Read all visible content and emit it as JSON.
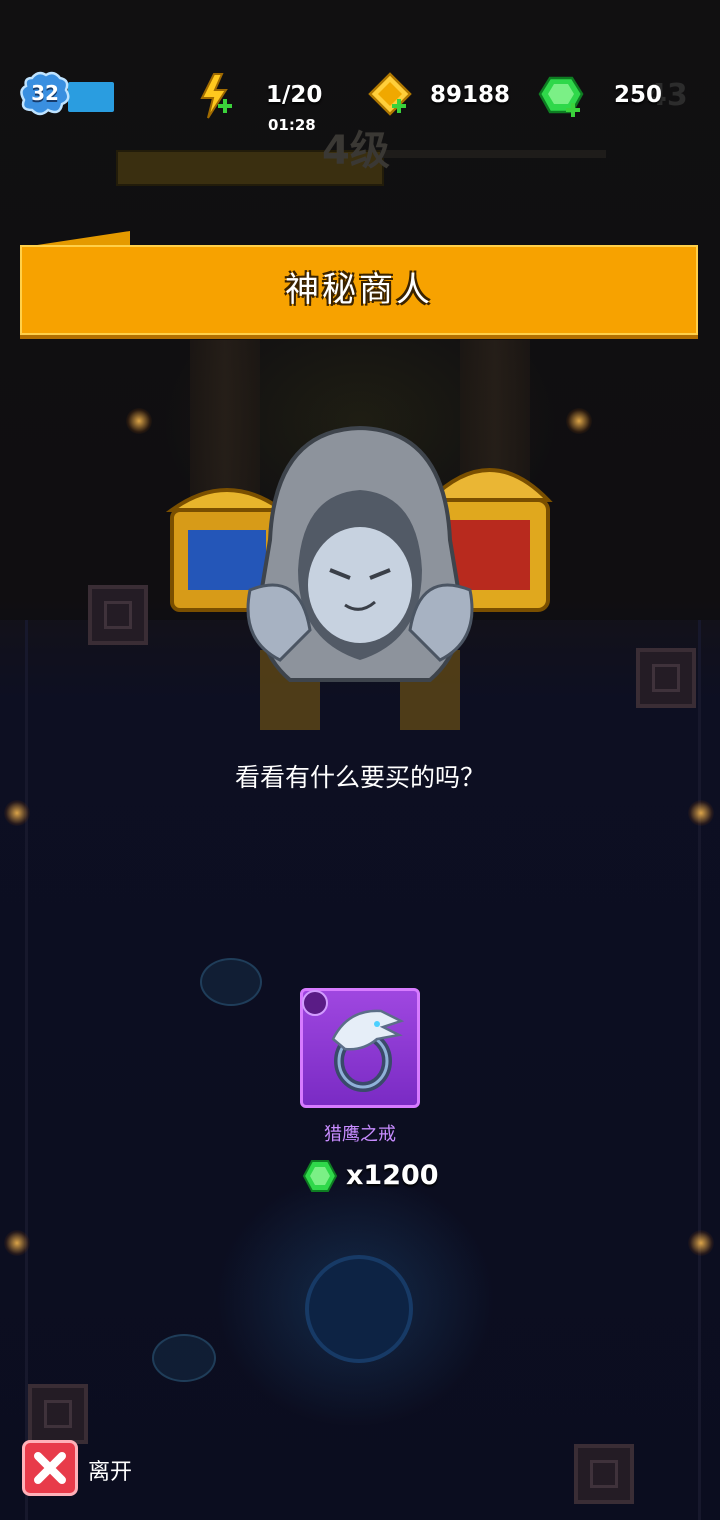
{
  "hud": {
    "player_level": "32",
    "energy": {
      "value": "1/20",
      "timer": "01:28",
      "icon": "lightning-plus-icon"
    },
    "gold": {
      "value": "89188",
      "icon": "gold-coin-plus-icon"
    },
    "gems": {
      "value": "250",
      "icon": "green-gem-plus-icon"
    },
    "background_number": "43",
    "background_level_text": "4级"
  },
  "dialog": {
    "title": "神秘商人",
    "prompt": "看看有什么要买的吗？"
  },
  "shop_item": {
    "name": "猎鹰之戒",
    "icon": "falcon-ring-icon",
    "price": "x1200",
    "currency_icon": "green-gem-icon"
  },
  "footer": {
    "leave_label": "离开",
    "leave_icon": "close-x-icon"
  },
  "colors": {
    "banner": "#f7a200",
    "item_frame": "#9f47e0",
    "leave_button": "#e83b4a",
    "xp_bar": "#2a9de0"
  }
}
